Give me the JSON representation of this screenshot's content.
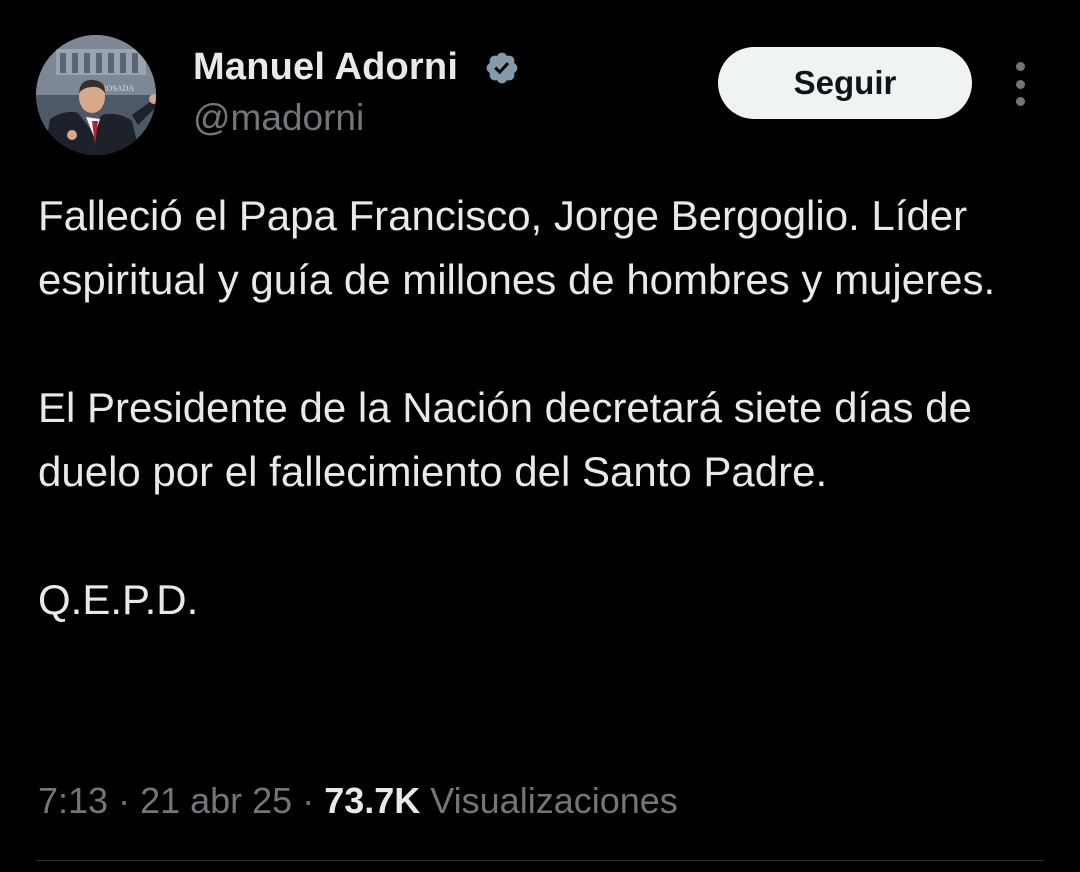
{
  "author": {
    "name": "Manuel Adorni",
    "handle": "@madorni",
    "verified_icon": "verified-badge-icon",
    "avatar_text": "A ROSADA"
  },
  "follow_button": {
    "label": "Seguir"
  },
  "more_menu": {
    "icon": "more-vertical-icon"
  },
  "tweet": {
    "paragraphs": [
      "Falleció el Papa Francisco, Jorge Bergoglio. Líder espiritual y guía de millones de hombres y mujeres.",
      "El Presidente de la Nación decretará siete días de duelo por el fallecimiento del Santo Padre.",
      "Q.E.P.D."
    ]
  },
  "meta": {
    "time": "7:13",
    "separator": " · ",
    "date": "21 abr 25",
    "views_count": "73.7K",
    "views_label": "Visualizaciones"
  },
  "colors": {
    "background": "#000000",
    "text_primary": "#e7e9ea",
    "text_secondary": "#71767b",
    "verified": "#829aab",
    "button_bg": "#eff3f4",
    "divider": "#2f3336"
  }
}
